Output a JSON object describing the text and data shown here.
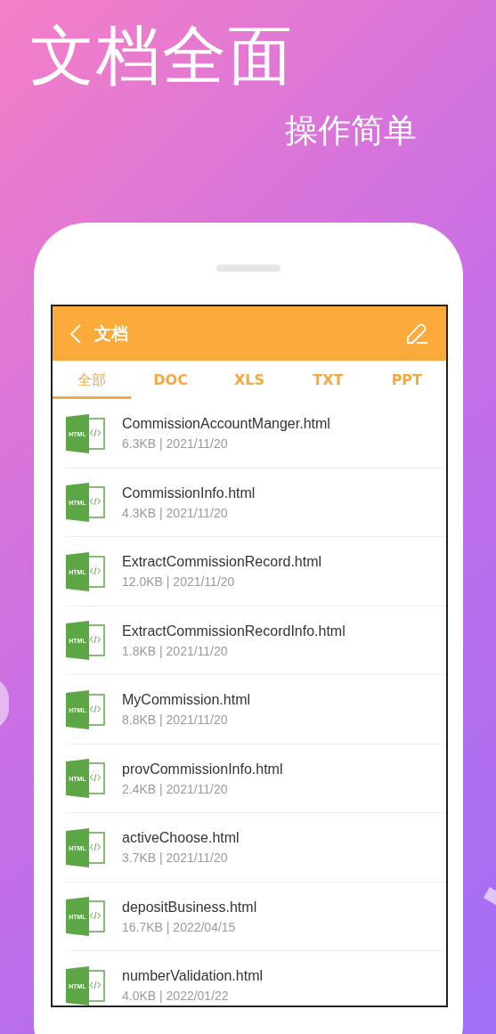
{
  "headline": "文档全面",
  "subheadline": "操作简单",
  "app_bar": {
    "title": "文档"
  },
  "tabs": [
    {
      "label": "全部",
      "selected": true
    },
    {
      "label": "DOC",
      "selected": false
    },
    {
      "label": "XLS",
      "selected": false
    },
    {
      "label": "TXT",
      "selected": false
    },
    {
      "label": "PPT",
      "selected": false
    }
  ],
  "files": [
    {
      "icon_text": "HTML",
      "name": "CommissionAccountManger.html",
      "meta": "6.3KB | 2021/11/20"
    },
    {
      "icon_text": "HTML",
      "name": "CommissionInfo.html",
      "meta": "4.3KB | 2021/11/20"
    },
    {
      "icon_text": "HTML",
      "name": "ExtractCommissionRecord.html",
      "meta": "12.0KB | 2021/11/20"
    },
    {
      "icon_text": "HTML",
      "name": "ExtractCommissionRecordInfo.html",
      "meta": "1.8KB | 2021/11/20"
    },
    {
      "icon_text": "HTML",
      "name": "MyCommission.html",
      "meta": "8.8KB | 2021/11/20"
    },
    {
      "icon_text": "HTML",
      "name": "provCommissionInfo.html",
      "meta": "2.4KB | 2021/11/20"
    },
    {
      "icon_text": "HTML",
      "name": "activeChoose.html",
      "meta": "3.7KB | 2021/11/20"
    },
    {
      "icon_text": "HTML",
      "name": "depositBusiness.html",
      "meta": "16.7KB | 2022/04/15"
    },
    {
      "icon_text": "HTML",
      "name": "numberValidation.html",
      "meta": "4.0KB | 2022/01/22"
    }
  ]
}
